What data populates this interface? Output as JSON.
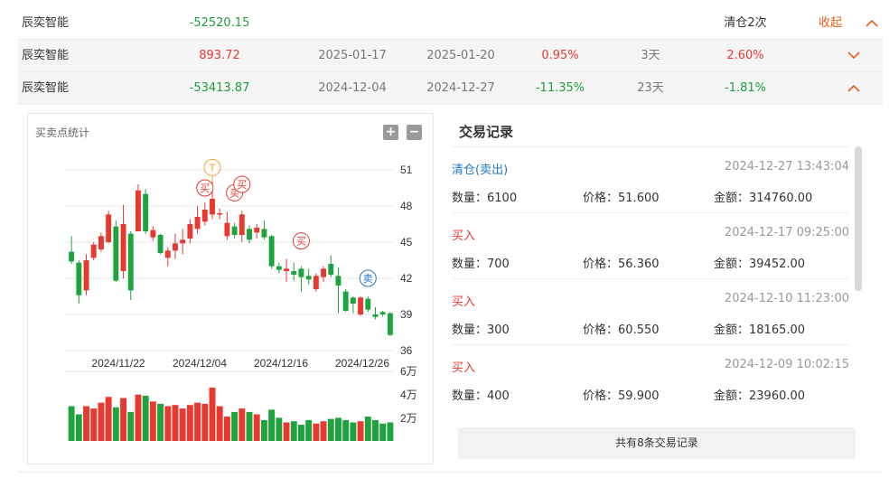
{
  "rows": [
    {
      "name": "辰奕智能",
      "pnl": "-52520.15",
      "pnl_sign": "neg",
      "status": "清仓2次",
      "toggle_label": "收起",
      "toggle_state": "up"
    },
    {
      "name": "辰奕智能",
      "pnl": "893.72",
      "pnl_sign": "pos",
      "buy_date": "2025-01-17",
      "sell_date": "2025-01-20",
      "pct": "0.95%",
      "pct_sign": "pos",
      "days": "3天",
      "rate": "2.60%",
      "rate_sign": "pos",
      "toggle_state": "down"
    },
    {
      "name": "辰奕智能",
      "pnl": "-53413.87",
      "pnl_sign": "neg",
      "buy_date": "2024-12-04",
      "sell_date": "2024-12-27",
      "pct": "-11.35%",
      "pct_sign": "neg",
      "days": "23天",
      "rate": "-1.81%",
      "rate_sign": "neg",
      "toggle_state": "up"
    }
  ],
  "chart": {
    "title": "买卖点统计",
    "zoom_in": "+",
    "zoom_out": "−"
  },
  "chart_data": {
    "type": "candlestick",
    "price_ticks": [
      51,
      48,
      45,
      42,
      39,
      36
    ],
    "price_range": [
      36,
      51
    ],
    "volume_ticks": [
      "6万",
      "4万",
      "2万"
    ],
    "volume_range": [
      0,
      60000
    ],
    "date_labels": [
      "2024/11/22",
      "2024/12/04",
      "2024/12/16",
      "2024/12/26"
    ],
    "candles": [
      {
        "o": 44.2,
        "c": 43.4,
        "h": 45.5,
        "l": 43.2,
        "v": 30000
      },
      {
        "o": 43.3,
        "c": 40.6,
        "h": 43.5,
        "l": 39.9,
        "v": 23000
      },
      {
        "o": 41.0,
        "c": 43.5,
        "h": 44.0,
        "l": 40.6,
        "v": 30000
      },
      {
        "o": 43.7,
        "c": 44.8,
        "h": 45.0,
        "l": 43.5,
        "v": 28000
      },
      {
        "o": 44.4,
        "c": 45.5,
        "h": 45.8,
        "l": 44.2,
        "v": 33000
      },
      {
        "o": 45.0,
        "c": 47.3,
        "h": 47.6,
        "l": 44.9,
        "v": 38000
      },
      {
        "o": 46.3,
        "c": 41.8,
        "h": 46.8,
        "l": 41.7,
        "v": 29000
      },
      {
        "o": 42.6,
        "c": 46.5,
        "h": 48.1,
        "l": 42.0,
        "v": 37000
      },
      {
        "o": 45.7,
        "c": 41.0,
        "h": 45.9,
        "l": 40.2,
        "v": 25000
      },
      {
        "o": 45.9,
        "c": 49.3,
        "h": 49.8,
        "l": 45.9,
        "v": 40000
      },
      {
        "o": 49.0,
        "c": 45.9,
        "h": 49.4,
        "l": 45.7,
        "v": 39000
      },
      {
        "o": 45.4,
        "c": 46.0,
        "h": 46.3,
        "l": 45.1,
        "v": 34000
      },
      {
        "o": 45.6,
        "c": 44.1,
        "h": 45.7,
        "l": 44.0,
        "v": 32000
      },
      {
        "o": 43.7,
        "c": 44.3,
        "h": 44.6,
        "l": 43.0,
        "v": 30000
      },
      {
        "o": 44.3,
        "c": 44.9,
        "h": 45.7,
        "l": 43.6,
        "v": 31000
      },
      {
        "o": 44.9,
        "c": 45.2,
        "h": 46.1,
        "l": 44.0,
        "v": 28000
      },
      {
        "o": 45.3,
        "c": 46.5,
        "h": 46.9,
        "l": 44.9,
        "v": 31000
      },
      {
        "o": 46.1,
        "c": 47.1,
        "h": 48.0,
        "l": 45.7,
        "v": 33000
      },
      {
        "o": 46.7,
        "c": 47.7,
        "h": 48.3,
        "l": 46.4,
        "v": 32000
      },
      {
        "o": 47.3,
        "c": 48.6,
        "h": 50.0,
        "l": 46.9,
        "v": 46000
      },
      {
        "o": 47.4,
        "c": 47.4,
        "h": 47.8,
        "l": 46.9,
        "v": 30000
      },
      {
        "o": 45.5,
        "c": 46.6,
        "h": 47.5,
        "l": 45.2,
        "v": 21000
      },
      {
        "o": 46.3,
        "c": 45.6,
        "h": 46.6,
        "l": 45.3,
        "v": 25000
      },
      {
        "o": 45.6,
        "c": 47.3,
        "h": 47.6,
        "l": 45.0,
        "v": 28000
      },
      {
        "o": 46.1,
        "c": 45.2,
        "h": 46.4,
        "l": 44.9,
        "v": 25000
      },
      {
        "o": 45.8,
        "c": 46.2,
        "h": 46.5,
        "l": 45.3,
        "v": 23000
      },
      {
        "o": 46.1,
        "c": 45.4,
        "h": 46.8,
        "l": 45.2,
        "v": 18000
      },
      {
        "o": 45.5,
        "c": 43.0,
        "h": 45.6,
        "l": 42.8,
        "v": 27000
      },
      {
        "o": 43.0,
        "c": 42.7,
        "h": 43.3,
        "l": 42.4,
        "v": 20000
      },
      {
        "o": 42.6,
        "c": 42.8,
        "h": 43.6,
        "l": 41.7,
        "v": 16000
      },
      {
        "o": 42.6,
        "c": 42.3,
        "h": 43.3,
        "l": 41.8,
        "v": 17000
      },
      {
        "o": 42.8,
        "c": 42.1,
        "h": 43.0,
        "l": 40.9,
        "v": 14000
      },
      {
        "o": 42.2,
        "c": 41.9,
        "h": 42.8,
        "l": 41.5,
        "v": 18000
      },
      {
        "o": 41.1,
        "c": 42.2,
        "h": 42.4,
        "l": 40.9,
        "v": 15000
      },
      {
        "o": 42.1,
        "c": 42.8,
        "h": 43.0,
        "l": 41.7,
        "v": 17000
      },
      {
        "o": 43.2,
        "c": 42.3,
        "h": 43.9,
        "l": 42.1,
        "v": 19000
      },
      {
        "o": 42.2,
        "c": 41.4,
        "h": 42.9,
        "l": 39.1,
        "v": 20000
      },
      {
        "o": 40.9,
        "c": 39.3,
        "h": 41.1,
        "l": 39.2,
        "v": 18000
      },
      {
        "o": 40.4,
        "c": 39.9,
        "h": 40.5,
        "l": 39.1,
        "v": 16000
      },
      {
        "o": 39.0,
        "c": 40.4,
        "h": 40.5,
        "l": 38.9,
        "v": 17000
      },
      {
        "o": 40.3,
        "c": 39.4,
        "h": 40.5,
        "l": 39.2,
        "v": 21000
      },
      {
        "o": 39.0,
        "c": 38.8,
        "h": 39.6,
        "l": 38.6,
        "v": 18000
      },
      {
        "o": 39.2,
        "c": 39.0,
        "h": 39.3,
        "l": 38.8,
        "v": 15000
      },
      {
        "o": 39.1,
        "c": 37.3,
        "h": 39.2,
        "l": 37.2,
        "v": 16000
      }
    ],
    "markers": [
      {
        "type": "T",
        "label": "T",
        "index": 19,
        "price": 50.0
      },
      {
        "type": "buy",
        "label": "买",
        "index": 18,
        "price": 48.3
      },
      {
        "type": "buy",
        "label": "买",
        "index": 22,
        "price": 47.9
      },
      {
        "type": "buy",
        "label": "买",
        "index": 23,
        "price": 48.6
      },
      {
        "type": "buy",
        "label": "买",
        "index": 31,
        "price": 43.9
      },
      {
        "type": "sell",
        "label": "卖",
        "index": 40,
        "price": 40.8
      }
    ],
    "colors": {
      "up": "#e8382f",
      "down": "#1fa33f",
      "grid": "#e4e4e4",
      "axis_text": "#333333",
      "T": "#f0a030",
      "buy": "#e8382f",
      "sell": "#1f79c2"
    }
  },
  "trades": {
    "title": "交易记录",
    "qty_label": "数量：",
    "price_label": "价格：",
    "amount_label": "金额：",
    "items": [
      {
        "type": "清仓(卖出)",
        "kind": "sell",
        "time": "2024-12-27 13:43:04",
        "qty": "6100",
        "price": "51.600",
        "amount": "314760.00"
      },
      {
        "type": "买入",
        "kind": "buy",
        "time": "2024-12-17 09:25:00",
        "qty": "700",
        "price": "56.360",
        "amount": "39452.00"
      },
      {
        "type": "买入",
        "kind": "buy",
        "time": "2024-12-10 11:23:00",
        "qty": "300",
        "price": "60.550",
        "amount": "18165.00"
      },
      {
        "type": "买入",
        "kind": "buy",
        "time": "2024-12-09 10:02:15",
        "qty": "400",
        "price": "59.900",
        "amount": "23960.00"
      }
    ],
    "more_label": "共有8条交易记录"
  }
}
